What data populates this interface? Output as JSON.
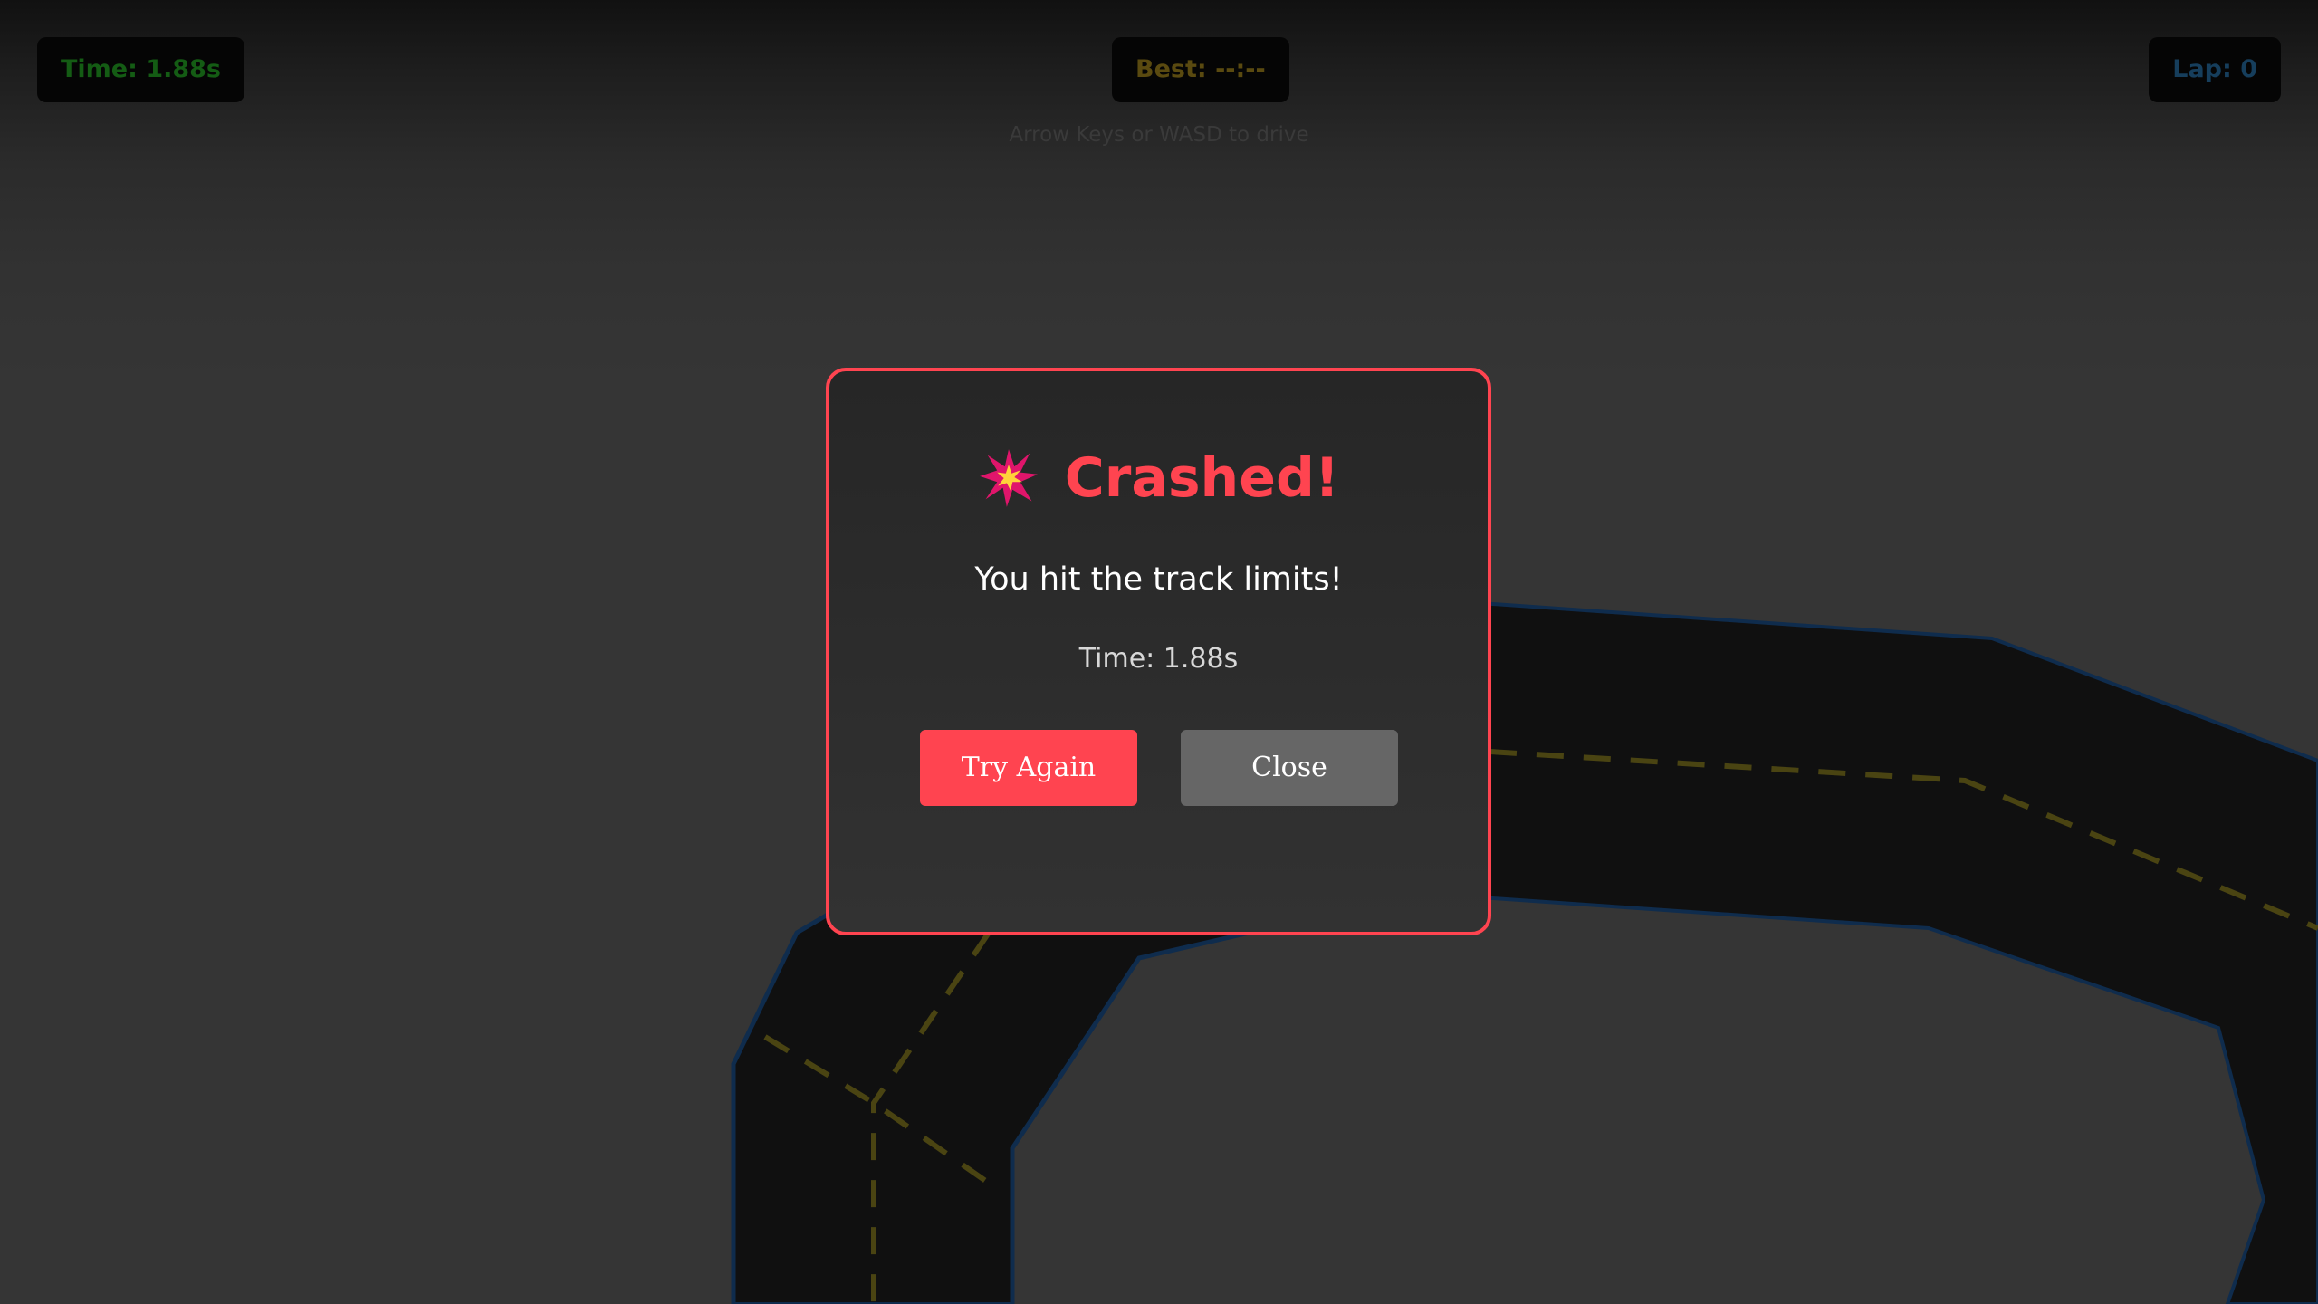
{
  "hud": {
    "time": "Time: 1.88s",
    "best": "Best: --:--",
    "lap": "Lap: 0"
  },
  "instructions": "Arrow Keys or WASD to drive",
  "modal": {
    "icon": "collision-icon",
    "title": "Crashed!",
    "message": "You hit the track limits!",
    "time": "Time: 1.88s",
    "try_again_label": "Try Again",
    "close_label": "Close"
  },
  "colors": {
    "accent": "#ff4450",
    "hud_time": "#145c14",
    "hud_best": "#5a4a10",
    "hud_lap": "#163e5c",
    "track": "#101010",
    "track_edge": "#0f2c4d",
    "center_line": "#4a4412"
  }
}
